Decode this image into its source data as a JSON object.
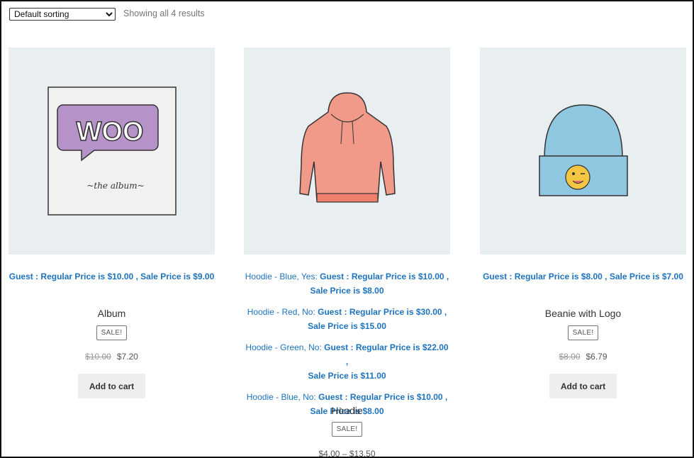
{
  "toolbar": {
    "sort_selected": "Default sorting",
    "result_count": "Showing all 4 results"
  },
  "products": [
    {
      "name": "Album",
      "pricing": [
        {
          "variation": "",
          "text": "Guest : Regular Price is $10.00 , Sale Price is $9.00"
        }
      ],
      "badge": "SALE!",
      "price_old": "$10.00",
      "price_new": "$7.20",
      "button": "Add to cart",
      "image": {
        "icon": "album-icon",
        "text": "WOO",
        "subtitle": "~the album~"
      }
    },
    {
      "name": "Hoodie",
      "pricing": [
        {
          "variation": "Hoodie - Blue, Yes:",
          "line1": "Guest : Regular Price is $10.00 ,",
          "line2": "Sale Price is $8.00"
        },
        {
          "variation": "Hoodie - Red, No:",
          "line1": "Guest : Regular Price is $30.00 ,",
          "line2": "Sale Price is $15.00"
        },
        {
          "variation": "Hoodie - Green, No:",
          "line1": "Guest : Regular Price is $22.00 ,",
          "line2": "Sale Price is $11.00"
        },
        {
          "variation": "Hoodie - Blue, No:",
          "line1": "Guest : Regular Price is $10.00 ,",
          "line2": "Sale Price is $8.00"
        }
      ],
      "badge": "SALE!",
      "price_range": "$4.00 – $13.50",
      "image": {
        "icon": "hoodie-icon"
      }
    },
    {
      "name": "Beanie with Logo",
      "pricing": [
        {
          "variation": "",
          "text": "Guest : Regular Price is $8.00 , Sale Price is $7.00"
        }
      ],
      "badge": "SALE!",
      "price_old": "$8.00",
      "price_new": "$6.79",
      "button": "Add to cart",
      "image": {
        "icon": "beanie-icon"
      }
    }
  ],
  "colors": {
    "link_blue": "#1e73be",
    "thumb_bg": "#e9eef1",
    "button_bg": "#eeeeee"
  }
}
